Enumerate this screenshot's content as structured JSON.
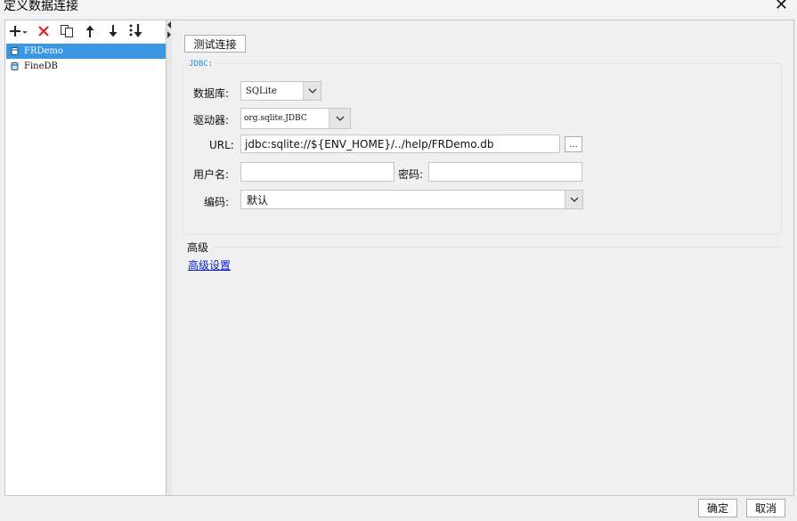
{
  "window": {
    "title": "定义数据连接",
    "close_glyph": "✕"
  },
  "toolbar": {
    "icons": [
      "add-dropdown-icon",
      "delete-icon",
      "copy-icon",
      "move-up-icon",
      "move-down-icon",
      "sort-icon"
    ]
  },
  "connections": [
    {
      "label": "FRDemo",
      "selected": true,
      "icon": "database-icon"
    },
    {
      "label": "FineDB",
      "selected": false,
      "icon": "database-icon"
    }
  ],
  "main": {
    "test_button": "测试连接",
    "group_title": "JDBC:",
    "db_label": "数据库:",
    "db_value": "SQLite",
    "driver_label": "驱动器:",
    "driver_value": "org.sqlite.JDBC",
    "url_label": "URL:",
    "url_value": "jdbc:sqlite://${ENV_HOME}/../help/FRDemo.db",
    "browse_button": "...",
    "user_label": "用户名:",
    "user_value": "",
    "password_label": "密码:",
    "password_value": "",
    "encoding_label": "编码:",
    "encoding_value": "默认",
    "advanced_title": "高级",
    "advanced_link": "高级设置"
  },
  "footer": {
    "ok": "确定",
    "cancel": "取消"
  },
  "colors": {
    "selection": "#3a96e0",
    "group_title": "#2c8fd1",
    "link": "#0b1fd0",
    "delete": "#e02424"
  }
}
